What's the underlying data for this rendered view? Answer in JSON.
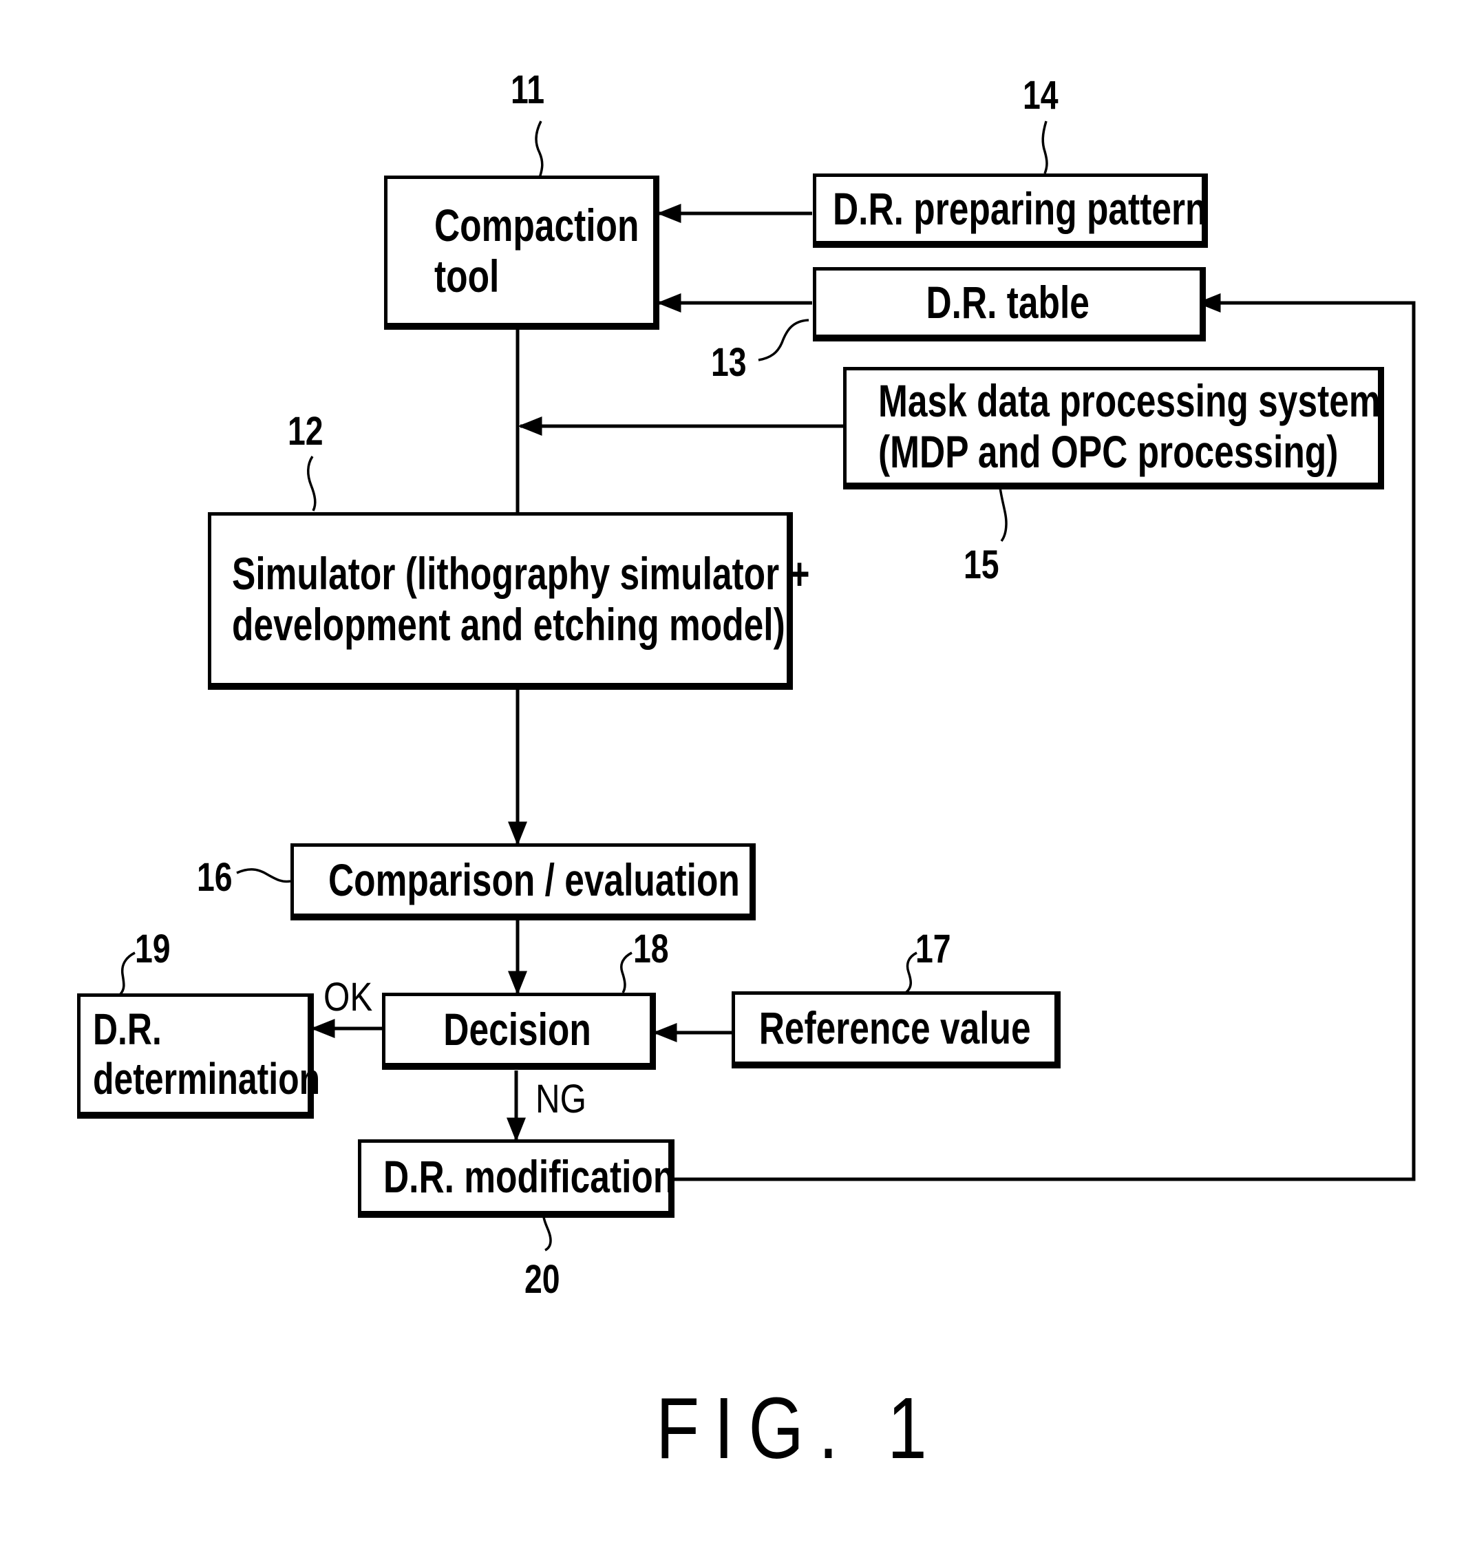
{
  "figure": {
    "caption": "FIG. 1",
    "type": "patent flowchart"
  },
  "blocks": {
    "compaction_tool": {
      "ref": "11",
      "line1": "Compaction",
      "line2": "tool"
    },
    "simulator": {
      "ref": "12",
      "line1": "Simulator (lithography simulator +",
      "line2": "development and etching model)"
    },
    "dr_table": {
      "ref": "13",
      "label": "D.R. table"
    },
    "dr_preparing_pattern": {
      "ref": "14",
      "label": "D.R. preparing pattern"
    },
    "mask_data_processing": {
      "ref": "15",
      "line1": "Mask data processing system",
      "line2": "(MDP and OPC processing)"
    },
    "comparison_evaluation": {
      "ref": "16",
      "label": "Comparison / evaluation"
    },
    "reference_value": {
      "ref": "17",
      "label": "Reference value"
    },
    "decision": {
      "ref": "18",
      "label": "Decision"
    },
    "dr_determination": {
      "ref": "19",
      "line1": "D.R.",
      "line2": "determination"
    },
    "dr_modification": {
      "ref": "20",
      "label": "D.R. modification"
    }
  },
  "edges": {
    "ok_label": "OK",
    "ng_label": "NG",
    "connections": [
      {
        "from": "D.R. preparing pattern",
        "to": "Compaction tool"
      },
      {
        "from": "D.R. table",
        "to": "Compaction tool"
      },
      {
        "from": "Compaction tool",
        "to": "Simulator"
      },
      {
        "from": "Mask data processing system",
        "to": "Simulator input line"
      },
      {
        "from": "Simulator",
        "to": "Comparison / evaluation"
      },
      {
        "from": "Comparison / evaluation",
        "to": "Decision"
      },
      {
        "from": "Reference value",
        "to": "Decision"
      },
      {
        "from": "Decision",
        "to": "D.R. determination",
        "label": "OK"
      },
      {
        "from": "Decision",
        "to": "D.R. modification",
        "label": "NG"
      },
      {
        "from": "D.R. modification",
        "to": "D.R. table"
      }
    ]
  }
}
